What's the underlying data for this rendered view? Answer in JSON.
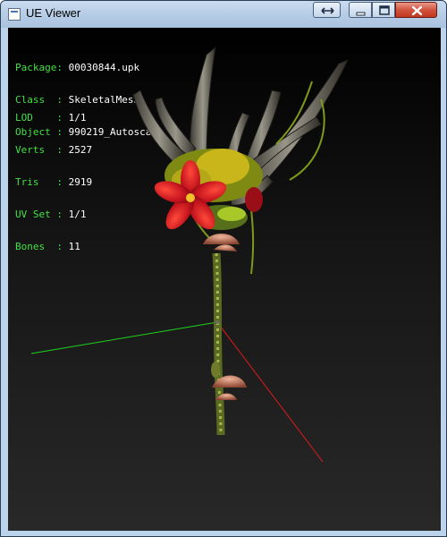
{
  "window": {
    "title": "UE Viewer"
  },
  "info": {
    "group1": [
      {
        "key": "Package",
        "value": "00030844.upk"
      },
      {
        "key": "Class  ",
        "value": "SkeletalMesh"
      },
      {
        "key": "Object ",
        "value": "990219_Autoscale"
      }
    ],
    "group2": [
      {
        "key": "LOD    ",
        "value": "1/1"
      },
      {
        "key": "Verts  ",
        "value": "2527"
      },
      {
        "key": "Tris   ",
        "value": "2919"
      },
      {
        "key": "UV Set ",
        "value": "1/1"
      },
      {
        "key": "Bones  ",
        "value": "11"
      }
    ]
  },
  "colors": {
    "info_key": "#43e143",
    "info_value": "#ffffff",
    "axis_x": "#ff2020",
    "axis_y": "#20d020"
  },
  "icons": [
    "app-icon",
    "resize-icon",
    "minimize-icon",
    "maximize-icon",
    "close-icon"
  ]
}
